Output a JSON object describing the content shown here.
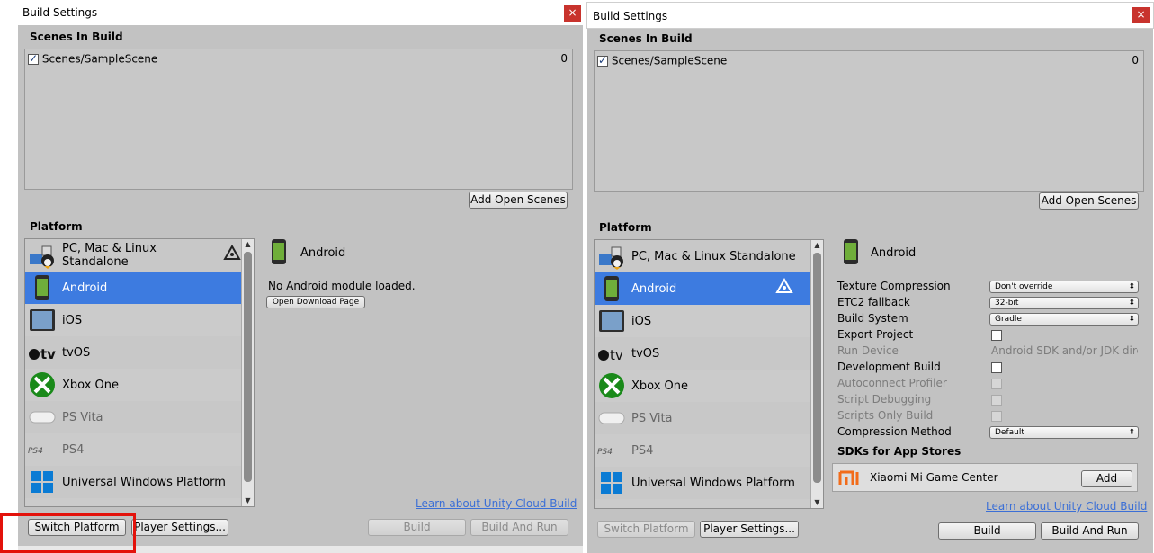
{
  "left": {
    "title": "Build Settings",
    "close": "×",
    "scenes_header": "Scenes In Build",
    "scenes": [
      {
        "name": "Scenes/SampleScene",
        "index": "0",
        "checked": true
      }
    ],
    "add_open_scenes": "Add Open Scenes",
    "platform_header": "Platform",
    "platforms": [
      {
        "label": "PC, Mac & Linux Standalone",
        "icon": "pc-mac-linux-icon",
        "active": true
      },
      {
        "label": "Android",
        "icon": "android-icon",
        "selected": true
      },
      {
        "label": "iOS",
        "icon": "ios-icon"
      },
      {
        "label": "tvOS",
        "icon": "tvos-icon"
      },
      {
        "label": "Xbox One",
        "icon": "xbox-icon"
      },
      {
        "label": "PS Vita",
        "icon": "ps-vita-icon"
      },
      {
        "label": "PS4",
        "icon": "ps4-icon"
      },
      {
        "label": "Universal Windows Platform",
        "icon": "windows-icon"
      }
    ],
    "detail_title": "Android",
    "no_module": "No Android module loaded.",
    "open_download": "Open Download Page",
    "cloud_link": "Learn about Unity Cloud Build",
    "switch_platform": "Switch Platform",
    "player_settings": "Player Settings...",
    "build": "Build",
    "build_and_run": "Build And Run"
  },
  "right": {
    "title": "Build Settings",
    "close": "×",
    "scenes_header": "Scenes In Build",
    "scenes": [
      {
        "name": "Scenes/SampleScene",
        "index": "0",
        "checked": true
      }
    ],
    "add_open_scenes": "Add Open Scenes",
    "platform_header": "Platform",
    "platforms": [
      {
        "label": "PC, Mac & Linux Standalone"
      },
      {
        "label": "Android",
        "selected": true,
        "active": true
      },
      {
        "label": "iOS"
      },
      {
        "label": "tvOS"
      },
      {
        "label": "Xbox One"
      },
      {
        "label": "PS Vita"
      },
      {
        "label": "PS4"
      },
      {
        "label": "Universal Windows Platform"
      }
    ],
    "detail_title": "Android",
    "settings": {
      "texture_compression": {
        "label": "Texture Compression",
        "value": "Don't override"
      },
      "etc2_fallback": {
        "label": "ETC2 fallback",
        "value": "32-bit"
      },
      "build_system": {
        "label": "Build System",
        "value": "Gradle"
      },
      "export_project": {
        "label": "Export Project",
        "checked": false
      },
      "run_device": {
        "label": "Run Device",
        "value": "Android SDK and/or JDK dire"
      },
      "development_build": {
        "label": "Development Build",
        "checked": false
      },
      "autoconnect_profiler": {
        "label": "Autoconnect Profiler"
      },
      "script_debugging": {
        "label": "Script Debugging"
      },
      "scripts_only_build": {
        "label": "Scripts Only Build"
      },
      "compression_method": {
        "label": "Compression Method",
        "value": "Default"
      }
    },
    "sdks_header": "SDKs for App Stores",
    "sdk_item": "Xiaomi Mi Game Center",
    "sdk_add": "Add",
    "cloud_link": "Learn about Unity Cloud Build",
    "switch_platform": "Switch Platform",
    "player_settings": "Player Settings...",
    "build": "Build",
    "build_and_run": "Build And Run"
  },
  "colors": {
    "selection": "#3d7be0",
    "highlight": "#e3120b",
    "link": "#3b6fd6"
  }
}
